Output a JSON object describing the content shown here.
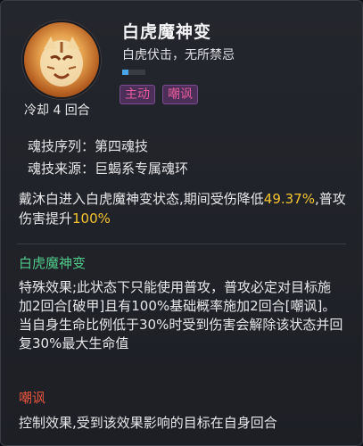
{
  "skill": {
    "name": "白虎魔神变",
    "subtitle": "白虎伏击，无所禁忌",
    "cooldown": "冷却 4 回合",
    "progress": 0.25,
    "tags": [
      "主动",
      "嘲讽"
    ]
  },
  "meta": {
    "sequence": "魂技序列：第四魂技",
    "source": "魂技来源：巨蝎系专属魂环"
  },
  "description": {
    "part1": "戴沐白进入白虎魔神变状态,期间受伤降低",
    "value1": "49.37%",
    "part2": ",普攻伤害提升",
    "value2": "100%"
  },
  "sections": [
    {
      "heading": "白虎魔神变",
      "text": "特殊效果;此状态下只能使用普攻，普攻必定对目标施加2回合[破甲]且有100%基础概率施加2回合[嘲讽]。当自身生命比例低于30%时受到伤害会解除该状态并回复30%最大生命值"
    },
    {
      "heading": "嘲讽",
      "text": "控制效果,受到该效果影响的目标在自身回合"
    }
  ],
  "colors": {
    "accent_green": "#51c98a",
    "accent_red": "#e8553f",
    "value_yellow": "#f4c431",
    "tag_pink": "#e45b9a",
    "bar_blue": "#4aa4e8"
  },
  "icons": {
    "avatar": "white-tiger-portrait"
  }
}
